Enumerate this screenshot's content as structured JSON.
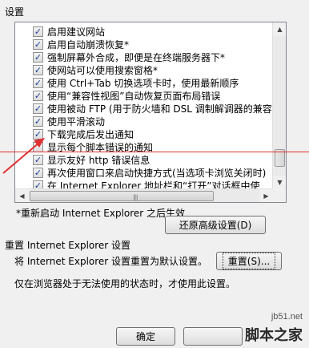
{
  "section_title": "设置",
  "settings_items": [
    {
      "label": "启用建议网站",
      "checked": true
    },
    {
      "label": "启用自动崩溃恢复*",
      "checked": true
    },
    {
      "label": "强制屏幕外合成，即便是在终端服务器下*",
      "checked": true
    },
    {
      "label": "使网站可以使用搜索窗格*",
      "checked": true
    },
    {
      "label": "使用 Ctrl+Tab 切换选项卡时，使用最新顺序",
      "checked": true
    },
    {
      "label": "使用“兼容性视图”自动恢复页面布局错误",
      "checked": true
    },
    {
      "label": "使用被动 FTP (用于防火墙和 DSL 调制解调器的兼容",
      "checked": true
    },
    {
      "label": "使用平滑滚动",
      "checked": true
    },
    {
      "label": "下载完成后发出通知",
      "checked": true
    },
    {
      "label": "显示每个脚本错误的通知",
      "checked": false
    },
    {
      "label": "显示友好 http 错误信息",
      "checked": true
    },
    {
      "label": "再次使用窗口来启动快捷方式(当选项卡浏览关闭时)",
      "checked": true
    },
    {
      "label": "在 Internet Explorer 地址栏和“打开”对话框中使",
      "checked": true
    }
  ],
  "restart_note": "*重新启动 Internet Explorer 之后生效",
  "restore_button": "还原高级设置(D)",
  "reset_section_title": "重置 Internet Explorer 设置",
  "reset_description": "将 Internet Explorer 设置重置为默认设置。",
  "reset_button": "重置(S)...",
  "reset_note": "仅在浏览器处于无法使用的状态时，才使用此设置。",
  "ok_button": "确定",
  "cancel_button": "",
  "watermark_url": "jb51.net",
  "watermark_name": "脚本之家",
  "colors": {
    "annotation_red": "#e03030",
    "check_blue": "#1c3f94"
  }
}
